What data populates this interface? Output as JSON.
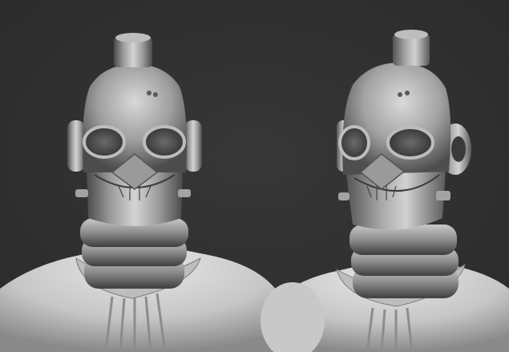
{
  "scene": {
    "background": "#2f2f2f",
    "material_light": "#d9d9d9",
    "material_mid": "#9a9a9a",
    "material_dark": "#3a3a3a",
    "views": [
      {
        "name": "front-view"
      },
      {
        "name": "three-quarter-view"
      }
    ]
  }
}
